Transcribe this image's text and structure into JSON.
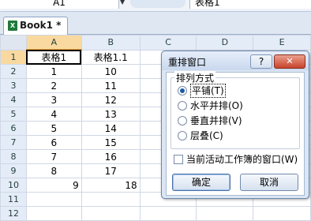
{
  "formula_bar": {
    "name_box": "A1",
    "value": "表格1"
  },
  "workbook_tab": {
    "icon": "excel-workbook-icon",
    "title": "Book1 *"
  },
  "sheet": {
    "columns": [
      "A",
      "B",
      "C",
      "D",
      "E"
    ],
    "rows": [
      {
        "num": "1",
        "a": "表格1",
        "b": "表格1.1"
      },
      {
        "num": "2",
        "a": "1",
        "b": "10"
      },
      {
        "num": "3",
        "a": "2",
        "b": "11"
      },
      {
        "num": "4",
        "a": "3",
        "b": "12"
      },
      {
        "num": "5",
        "a": "4",
        "b": "13"
      },
      {
        "num": "6",
        "a": "5",
        "b": "14"
      },
      {
        "num": "7",
        "a": "6",
        "b": "15"
      },
      {
        "num": "8",
        "a": "7",
        "b": "16"
      },
      {
        "num": "9",
        "a": "8",
        "b": "17"
      },
      {
        "num": "10",
        "a": "9",
        "b": "18"
      },
      {
        "num": "11",
        "a": "",
        "b": ""
      },
      {
        "num": "12",
        "a": "",
        "b": ""
      }
    ]
  },
  "dialog": {
    "title": "重排窗口",
    "help_label": "?",
    "close_label": "✕",
    "group_label": "排列方式",
    "options": [
      {
        "label": "平铺(T)",
        "selected": true
      },
      {
        "label": "水平并排(O)",
        "selected": false
      },
      {
        "label": "垂直并排(V)",
        "selected": false
      },
      {
        "label": "层叠(C)",
        "selected": false
      }
    ],
    "checkbox_label": "当前活动工作簿的窗口(W)",
    "checkbox_checked": false,
    "ok_label": "确定",
    "cancel_label": "取消"
  }
}
